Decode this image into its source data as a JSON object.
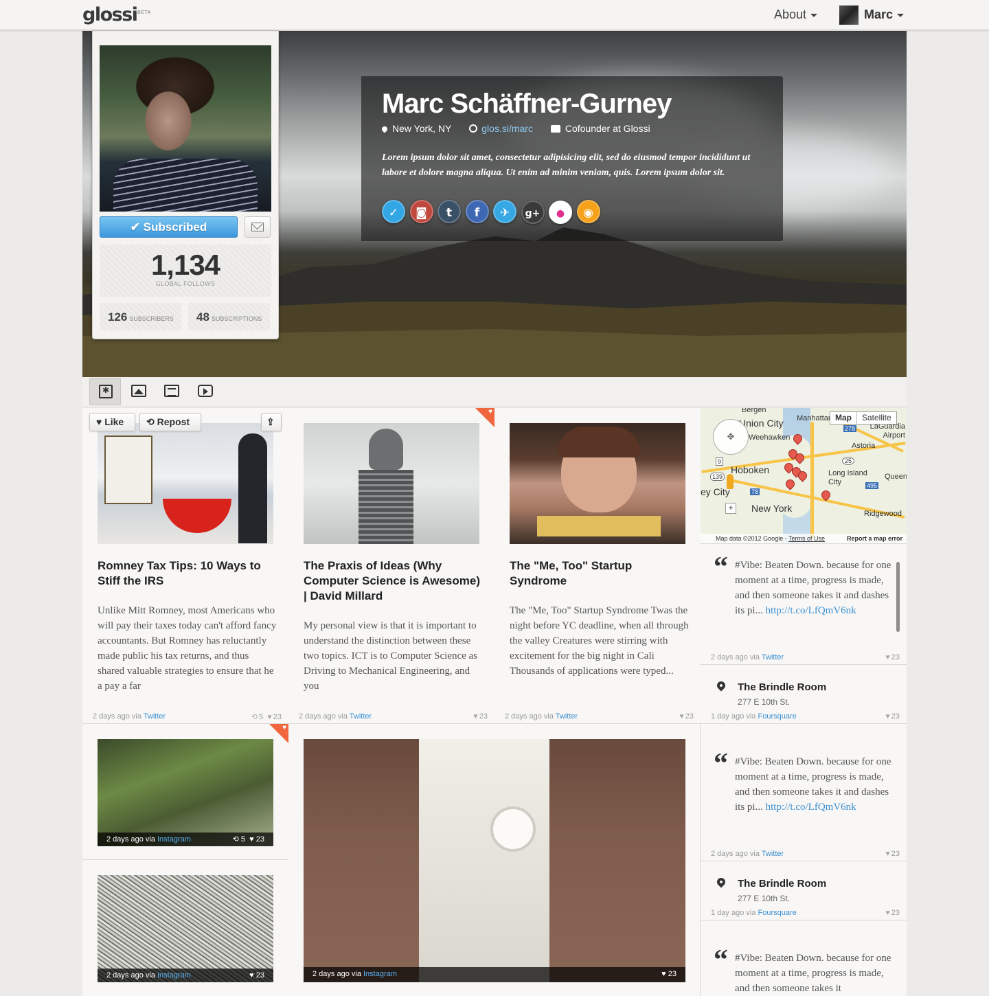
{
  "nav": {
    "logo": "glossi",
    "beta": "BETA",
    "about": "About",
    "user": "Marc"
  },
  "profile": {
    "name": "Marc Schäffner-Gurney",
    "location": "New York, NY",
    "url": "glos.si/marc",
    "job": "Cofounder at Glossi",
    "bio": "Lorem ipsum dolor sit amet, consectetur adipisicing elit, sed do eiusmod tempor incididunt ut labore et dolore magna aliqua. Ut enim ad minim veniam, quis. Lorem ipsum dolor sit.",
    "subscribe_label": "✔ Subscribed",
    "follows": "1,134",
    "follows_label": "GLOBAL FOLLOWS",
    "subscribers": "126",
    "subscribers_label": "SUBSCRIBERS",
    "subscriptions": "48",
    "subscriptions_label": "SUBSCRIPTIONS"
  },
  "socials": [
    {
      "name": "foursquare",
      "glyph": "✓",
      "color": "#33a6e6"
    },
    {
      "name": "instagram",
      "glyph": "◙",
      "color": "#c0473c"
    },
    {
      "name": "tumblr",
      "glyph": "t",
      "color": "#3a5066"
    },
    {
      "name": "facebook",
      "glyph": "f",
      "color": "#3e67b4"
    },
    {
      "name": "twitter",
      "glyph": "✈",
      "color": "#36a8e4"
    },
    {
      "name": "googleplus",
      "glyph": "g+",
      "color": "#3a3a3a"
    },
    {
      "name": "flickr",
      "glyph": "●",
      "color": "#ffffff"
    },
    {
      "name": "rss",
      "glyph": "◉",
      "color": "#f5a11a"
    }
  ],
  "card_actions": {
    "like": "Like",
    "repost": "Repost"
  },
  "articles": [
    {
      "title": "Romney Tax Tips: 10 Ways to Stiff the IRS",
      "body": "Unlike Mitt Romney, most Americans who will pay their taxes today can't afford fancy accountants. But Romney has reluctantly made public his tax returns, and thus shared valuable strategies to ensure that he a pay a far",
      "time": "2 days ago via",
      "via": "Twitter",
      "reposts": "5",
      "likes": "23"
    },
    {
      "title": "The Praxis of Ideas (Why Computer Science is Awesome) | David Millard",
      "body": "My personal view is that it is important to understand the distinction between these two topics. ICT is to Computer Science as Driving to Mechanical Engineering, and you",
      "time": "2 days ago via",
      "via": "Twitter",
      "likes": "23"
    },
    {
      "title": "The \"Me, Too\" Startup Syndrome",
      "body": "The \"Me, Too\" Startup Syndrome Twas the night before YC deadline, when all through the valley Creatures were stirring with excitement for the big night in Cali Thousands of applications were typed...",
      "time": "2 days ago via",
      "via": "Twitter",
      "likes": "23"
    }
  ],
  "photos": [
    {
      "time": "2 days ago via",
      "via": "Instagram",
      "reposts": "5",
      "likes": "23"
    },
    {
      "time": "2 days ago via",
      "via": "Instagram",
      "likes": "23"
    },
    {
      "time": "2 days ago via",
      "via": "Instagram",
      "likes": "23"
    }
  ],
  "map": {
    "tab_map": "Map",
    "tab_satellite": "Satellite",
    "labels": {
      "bergen": "Bergen",
      "union_city": "Union City",
      "manhattan": "Manhattan",
      "weehawken": "Weehawken",
      "laguardia": "LaGuardia Airport",
      "astoria": "Astoria",
      "hoboken": "Hoboken",
      "long_island_city": "Long Island City",
      "queens": "Queens",
      "jersey_city": "ey City",
      "new_york": "New York",
      "ridgewood": "Ridgewood",
      "r278": "278",
      "r25": "25",
      "r139": "139",
      "r78": "78",
      "r495": "495",
      "r9": "9"
    },
    "copyright": "Map data ©2012 Google",
    "terms": "Terms of Use",
    "report": "Report a map error"
  },
  "sidebar": [
    {
      "type": "quote",
      "text": "#Vibe: Beaten Down. because for one moment at a time, progress is made, and then someone takes it and dashes its pi...",
      "link": "http://t.co/LfQmV6nk",
      "time": "2 days ago via",
      "via": "Twitter",
      "likes": "23"
    },
    {
      "type": "place",
      "name": "The Brindle Room",
      "address": "277 E 10th St.",
      "time": "1 day ago via",
      "via": "Foursquare",
      "likes": "23"
    },
    {
      "type": "quote",
      "text": "#Vibe: Beaten Down. because for one moment at a time, progress is made, and then someone takes it and dashes its pi...",
      "link": "http://t.co/LfQmV6nk",
      "time": "2 days ago via",
      "via": "Twitter",
      "likes": "23"
    },
    {
      "type": "place",
      "name": "The Brindle Room",
      "address": "277 E 10th St.",
      "time": "1 day ago via",
      "via": "Foursquare",
      "likes": "23"
    },
    {
      "type": "quote",
      "text": "#Vibe: Beaten Down. because for one moment at a time, progress is made, and then someone takes it"
    }
  ]
}
